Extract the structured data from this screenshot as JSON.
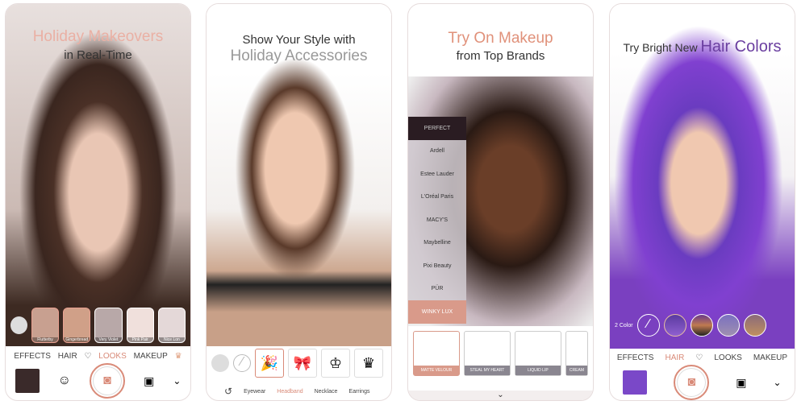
{
  "colors": {
    "accent": "#d98a78",
    "hair_purple": "#6b3fa0"
  },
  "panels": [
    {
      "title_line1": "Holiday Makeovers",
      "title_line2": "in Real-Time",
      "looks": [
        "Flutterby",
        "Gingerbread",
        "Very Violet",
        "Pink Pair",
        "Nice Lon"
      ],
      "tabs": [
        "EFFECTS",
        "HAIR",
        "♡",
        "LOOKS",
        "MAKEUP",
        "♛"
      ],
      "active_tab": "LOOKS",
      "icons": [
        "photo-thumbnail",
        "face-icon",
        "camera-icon",
        "video-icon",
        "chevron-down-icon"
      ]
    },
    {
      "title_line1": "Show Your Style with",
      "title_line2": "Holiday Accessories",
      "categories": [
        "Eyewear",
        "Headband",
        "Necklace",
        "Earrings"
      ],
      "active_category": "Headband"
    },
    {
      "title_line1": "Try On Makeup",
      "title_line2": "from Top Brands",
      "brands": [
        "PERFECT",
        "Ardell",
        "Estee Lauder",
        "L'Oréal Paris",
        "MACY'S",
        "Maybelline",
        "Pixi Beauty",
        "PÜR",
        "WINKY LUX"
      ],
      "active_brand": "WINKY LUX",
      "products": [
        "MATTE VELOUR",
        "STEAL MY HEART",
        "LIQUID LIP",
        "CREAM"
      ]
    },
    {
      "title_line1": "Try Bright New",
      "title_line2": "Hair Colors",
      "color_mode": "2 Color",
      "tabs": [
        "EFFECTS",
        "HAIR",
        "♡",
        "LOOKS",
        "MAKEUP"
      ],
      "active_tab": "HAIR"
    }
  ]
}
